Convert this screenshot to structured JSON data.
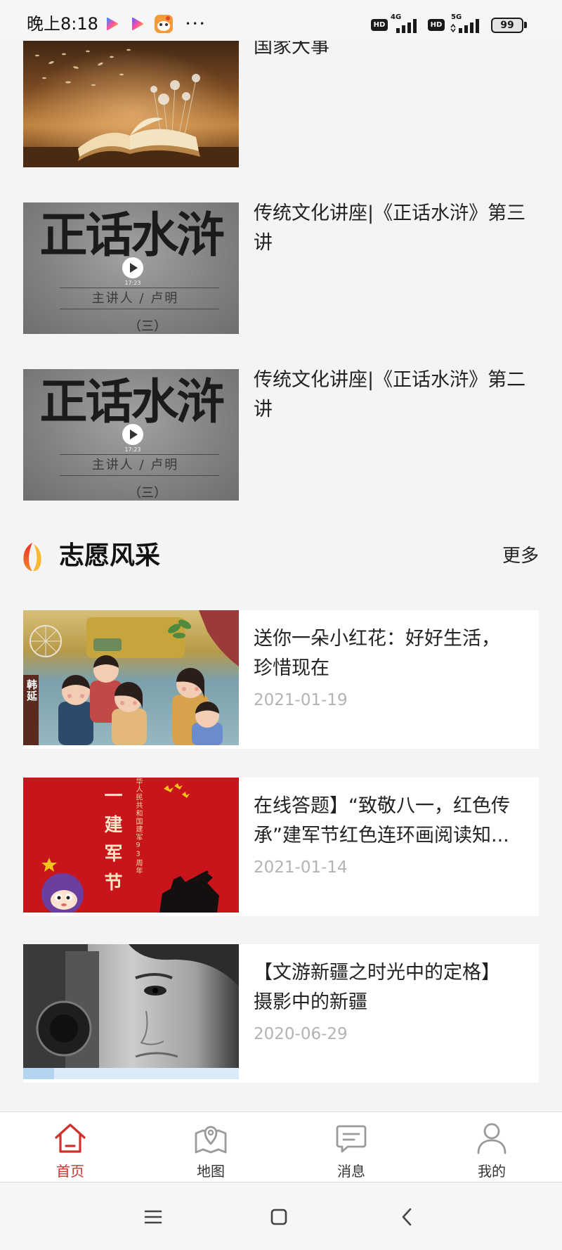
{
  "status_bar": {
    "time": "晚上8:18",
    "app_icons": [
      "video-play-app-icon",
      "video-play-app-icon",
      "cartoon-app-icon"
    ],
    "overflow": "•••",
    "sim1": {
      "hd": "HD",
      "network": "4G"
    },
    "sim2": {
      "hd": "HD",
      "network": "5G"
    },
    "battery_level": "99"
  },
  "news": {
    "items": [
      {
        "title_lines": [
          "国家大事"
        ]
      },
      {
        "title_lines": [
          "传统文化讲座|《正话水浒》第三",
          "讲"
        ]
      },
      {
        "title_lines": [
          "传统文化讲座|《正话水浒》第二",
          "讲"
        ]
      }
    ],
    "video_thumbnail": {
      "calligraphy": "正话水浒",
      "duration": "17:23",
      "lecturer": "主讲人 / 卢明",
      "episode": "（三）"
    }
  },
  "volunteer": {
    "icon": "flame-icon",
    "title": "志愿风采",
    "more": "更多",
    "items": [
      {
        "title_lines": [
          "送你一朵小红花：好好生活，",
          "珍惜现在"
        ],
        "date": "2021-01-19",
        "thumb_text": "韩延"
      },
      {
        "title_lines": [
          "在线答题】“致敬八一，红色传",
          "承”建军节红色连环画阅读知..."
        ],
        "date": "2021-01-14",
        "thumb_text": "一建军节",
        "thumb_subtext": "华人民共和国建军93周年"
      },
      {
        "title_lines": [
          "【文游新疆之时光中的定格】",
          "摄影中的新疆"
        ],
        "date": "2020-06-29"
      }
    ]
  },
  "tab_bar": {
    "active_color": "#d0312d",
    "inactive_color": "#9a9a9a",
    "items": [
      {
        "label": "首页",
        "icon": "home-icon",
        "active": true
      },
      {
        "label": "地图",
        "icon": "map-icon",
        "active": false
      },
      {
        "label": "消息",
        "icon": "message-icon",
        "active": false
      },
      {
        "label": "我的",
        "icon": "profile-icon",
        "active": false
      }
    ]
  },
  "system_nav": {
    "buttons": [
      "menu-icon",
      "home-square-icon",
      "back-icon"
    ]
  }
}
